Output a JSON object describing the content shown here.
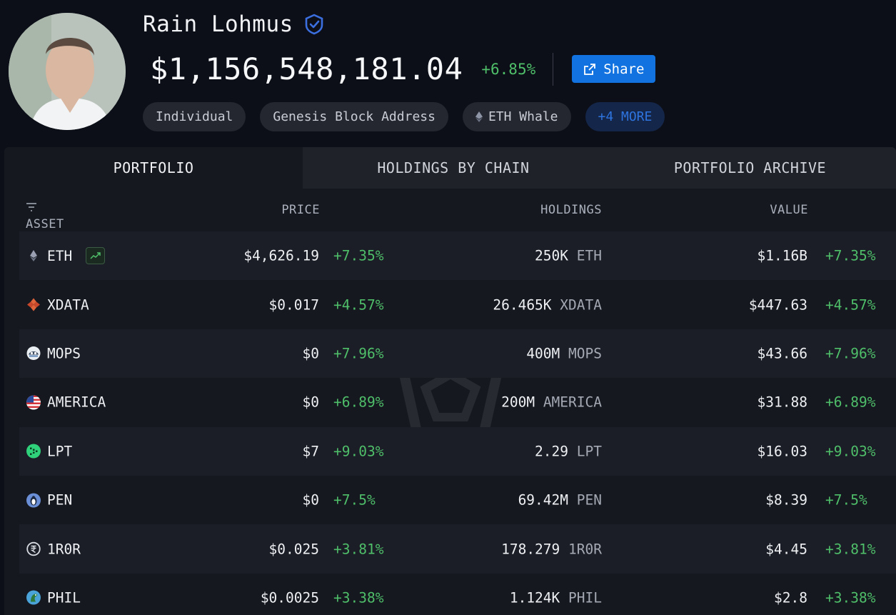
{
  "profile": {
    "name": "Rain Lohmus",
    "verified_icon": "verified-badge-icon",
    "total_value": "$1,156,548,181.04",
    "total_change": "+6.85%",
    "share_label": "Share",
    "tags": [
      {
        "label": "Individual"
      },
      {
        "label": "Genesis Block Address"
      },
      {
        "label": "ETH Whale",
        "icon": "eth-icon"
      },
      {
        "label": "+4 MORE"
      }
    ]
  },
  "tabs": [
    {
      "label": "PORTFOLIO",
      "active": true
    },
    {
      "label": "HOLDINGS BY CHAIN",
      "active": false
    },
    {
      "label": "PORTFOLIO ARCHIVE",
      "active": false
    }
  ],
  "table": {
    "headers": {
      "asset": "ASSET",
      "price": "PRICE",
      "holdings": "HOLDINGS",
      "value": "VALUE"
    },
    "rows": [
      {
        "asset": "ETH",
        "icon": "eth-icon",
        "price": "$4,626.19",
        "price_change": "+7.35%",
        "holdings_amount": "250K",
        "holdings_symbol": "ETH",
        "value": "$1.16B",
        "value_change": "+7.35%"
      },
      {
        "asset": "XDATA",
        "icon": "xdata-icon",
        "price": "$0.017",
        "price_change": "+4.57%",
        "holdings_amount": "26.465K",
        "holdings_symbol": "XDATA",
        "value": "$447.63",
        "value_change": "+4.57%"
      },
      {
        "asset": "MOPS",
        "icon": "mops-icon",
        "price": "$0",
        "price_change": "+7.96%",
        "holdings_amount": "400M",
        "holdings_symbol": "MOPS",
        "value": "$43.66",
        "value_change": "+7.96%"
      },
      {
        "asset": "AMERICA",
        "icon": "us-flag-icon",
        "price": "$0",
        "price_change": "+6.89%",
        "holdings_amount": "200M",
        "holdings_symbol": "AMERICA",
        "value": "$31.88",
        "value_change": "+6.89%"
      },
      {
        "asset": "LPT",
        "icon": "lpt-icon",
        "price": "$7",
        "price_change": "+9.03%",
        "holdings_amount": "2.29",
        "holdings_symbol": "LPT",
        "value": "$16.03",
        "value_change": "+9.03%"
      },
      {
        "asset": "PEN",
        "icon": "pen-icon",
        "price": "$0",
        "price_change": "+7.5%",
        "holdings_amount": "69.42M",
        "holdings_symbol": "PEN",
        "value": "$8.39",
        "value_change": "+7.5%"
      },
      {
        "asset": "1R0R",
        "icon": "1r0r-icon",
        "price": "$0.025",
        "price_change": "+3.81%",
        "holdings_amount": "178.279",
        "holdings_symbol": "1R0R",
        "value": "$4.45",
        "value_change": "+3.81%"
      },
      {
        "asset": "PHIL",
        "icon": "phil-icon",
        "price": "$0.0025",
        "price_change": "+3.38%",
        "holdings_amount": "1.124K",
        "holdings_symbol": "PHIL",
        "value": "$2.8",
        "value_change": "+3.38%"
      }
    ]
  },
  "colors": {
    "background": "#0c0f17",
    "panel": "#15181f",
    "positive": "#4fbf6a",
    "accent": "#1172e0",
    "more_tag": "#2e74df"
  }
}
